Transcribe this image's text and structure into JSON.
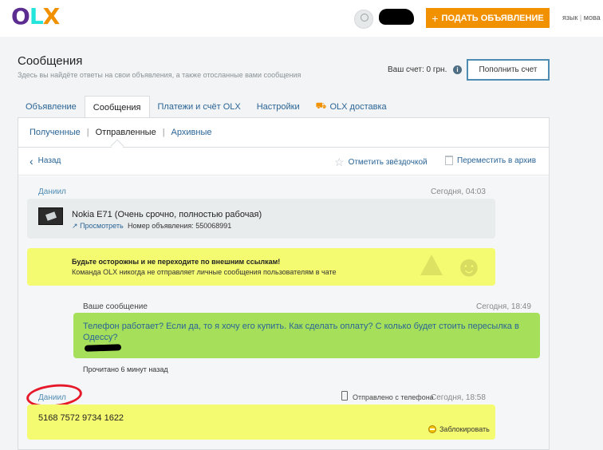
{
  "header": {
    "logo": {
      "o": "O",
      "l": "L",
      "x": "X"
    },
    "post_button": "ПОДАТЬ ОБЪЯВЛЕНИЕ",
    "lang": [
      "язык",
      "мова"
    ]
  },
  "page": {
    "title": "Сообщения",
    "subtitle": "Здесь вы найдёте ответы на свои объявления, а также отосланные вами сообщения",
    "account_label": "Ваш счет: 0 грн.",
    "info_icon": "i",
    "topup_button": "Пополнить счет"
  },
  "tabs": [
    "Объявление",
    "Сообщения",
    "Платежи и счёт OLX",
    "Настройки",
    "OLX доставка"
  ],
  "subtabs": [
    "Полученные",
    "Отправленные",
    "Архивные"
  ],
  "toolbar": {
    "back": "Назад",
    "star": "Отметить звёздочкой",
    "archive": "Переместить в архив"
  },
  "conversation": {
    "first_author": "Даниил",
    "first_date": "Сегодня, 04:03",
    "ad": {
      "title": "Nokia E71 (Очень срочно, полностью рабочая)",
      "view_link": "Просмотреть",
      "number": "Номер объявления: 550068991"
    },
    "warning": {
      "line1": "Будьте осторожны и не переходите по внешним ссылкам!",
      "line2": "Команда OLX никогда не отправляет личные сообщения пользователям в чате"
    },
    "my_message": {
      "label": "Ваше сообщение",
      "date": "Сегодня, 18:49",
      "text": "Телефон работает? Если да, то я хочу его купить. Как сделать оплату? С колько будет стоить пересылка в Одессу?",
      "status": "Прочитано 6 минут назад"
    },
    "reply": {
      "author": "Даниил",
      "sent_from": "Отправлено с телефона",
      "date": "Сегодня, 18:58",
      "text": "5168 7572 9734 1622",
      "block": "Заблокировать"
    }
  },
  "colors": {
    "brand_orange": "#f29100",
    "link_blue": "#2a6496",
    "highlight_yellow": "#f5fb70",
    "my_bubble_green": "#a6e05a",
    "annotation_red": "#e6192b"
  },
  "icons": [
    "user-avatar-icon",
    "plus-icon",
    "info-icon",
    "truck-icon",
    "chevron-left-icon",
    "star-icon",
    "trash-icon",
    "warning-icon",
    "phone-icon",
    "block-icon",
    "external-link-icon"
  ]
}
